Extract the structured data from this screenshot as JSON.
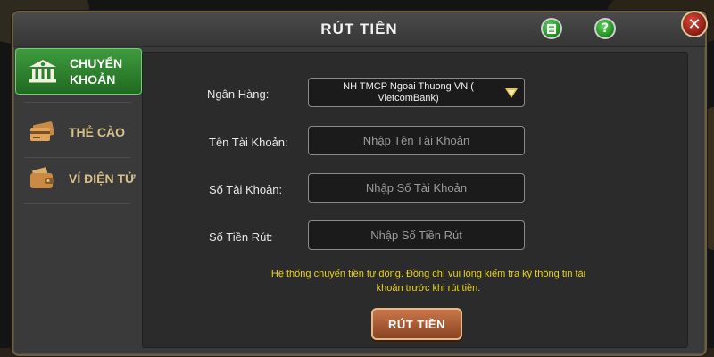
{
  "dialog": {
    "title": "RÚT TIỀN",
    "icons": {
      "notes": "notes-icon",
      "help": "help-icon",
      "close": "close-icon"
    },
    "help_glyph": "?",
    "close_glyph": "✕"
  },
  "sidebar": {
    "items": [
      {
        "line1": "CHUYỂN",
        "line2": "KHOẢN",
        "icon": "bank-icon",
        "active": true
      },
      {
        "line1": "THẺ CÀO",
        "line2": "",
        "icon": "card-icon",
        "active": false
      },
      {
        "line1": "VÍ ĐIỆN TỬ",
        "line2": "",
        "icon": "wallet-icon",
        "active": false
      }
    ]
  },
  "form": {
    "bank": {
      "label": "Ngân Hàng:",
      "value": "NH TMCP Ngoai Thuong VN ( VietcomBank)"
    },
    "account_name": {
      "label": "Tên Tài Khoản:",
      "placeholder": "Nhập Tên Tài Khoản"
    },
    "account_number": {
      "label": "Số Tài Khoản:",
      "placeholder": "Nhập Số Tài Khoản"
    },
    "amount": {
      "label": "Số Tiền Rút:",
      "placeholder": "Nhập Số Tiền Rút"
    },
    "notice": "Hệ thống chuyển tiền tự động. Đồng chí vui lòng kiểm tra kỹ thông tin tài khoản trước khi rút tiền.",
    "submit_label": "RÚT TIỀN"
  },
  "colors": {
    "accent_green": "#2e8b2e",
    "notice_yellow": "#e8d21e",
    "submit_brown": "#a85a32"
  }
}
